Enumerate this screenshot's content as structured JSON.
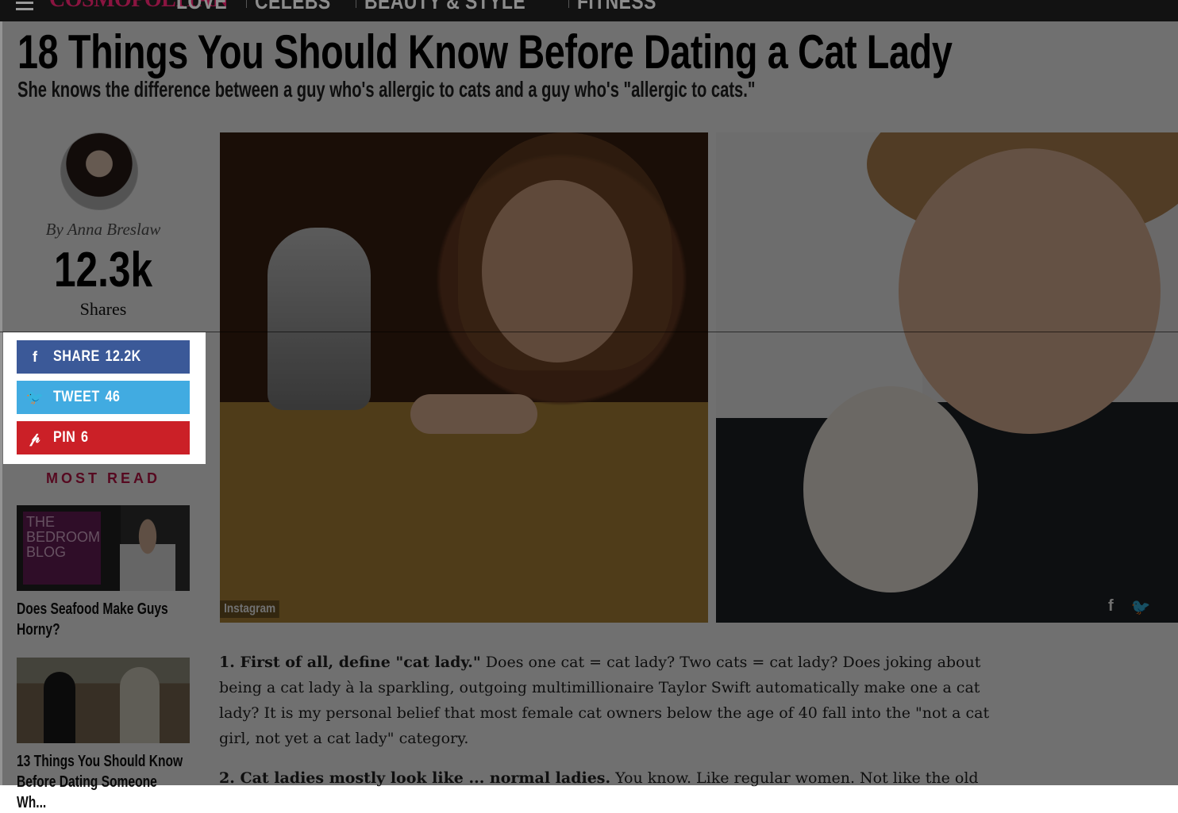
{
  "nav": {
    "logo": "COSMOPOLITAN",
    "items": [
      "LOVE",
      "CELEBS",
      "BEAUTY & STYLE",
      "FITNESS"
    ]
  },
  "article": {
    "headline": "18 Things You Should Know Before Dating a Cat Lady",
    "subhead": "She knows the difference between a guy who's allergic to cats and a guy who's \"allergic to cats.\"",
    "byline": "By Anna Breslaw",
    "share_count": "12.3k",
    "shares_label": "Shares",
    "photo_credit": "Instagram",
    "paragraphs": [
      {
        "lead": "1. First of all, define \"cat lady.\"",
        "body": " Does one cat = cat lady? Two cats = cat lady? Does joking about being a cat lady à la sparkling, outgoing multimillionaire Taylor Swift automatically make one a cat lady? It is my personal belief that most female cat owners below the age of 40 fall into the \"not a cat girl, not yet a cat lady\" category."
      },
      {
        "lead": "2. Cat ladies mostly look like ... normal ladies.",
        "body": " You know. Like regular women. Not like the old"
      }
    ]
  },
  "share": {
    "facebook": {
      "label": "SHARE",
      "count": "12.2K",
      "icon": "f"
    },
    "twitter": {
      "label": "TWEET",
      "count": "46",
      "icon": "🐦"
    },
    "pinterest": {
      "label": "PIN",
      "count": "6",
      "icon": "𝓅"
    }
  },
  "photo_share_icons": {
    "facebook": "f",
    "twitter": "🐦"
  },
  "most_read": {
    "title": "MOST READ",
    "items": [
      {
        "thumb_text": "THE BEDROOM BLOG",
        "title": "Does Seafood Make Guys Horny?"
      },
      {
        "title": "13 Things You Should Know Before Dating Someone Wh..."
      }
    ]
  },
  "colors": {
    "brand": "#c4154a",
    "facebook": "#3b5998",
    "twitter": "#41abe1",
    "pinterest": "#cb2027"
  }
}
